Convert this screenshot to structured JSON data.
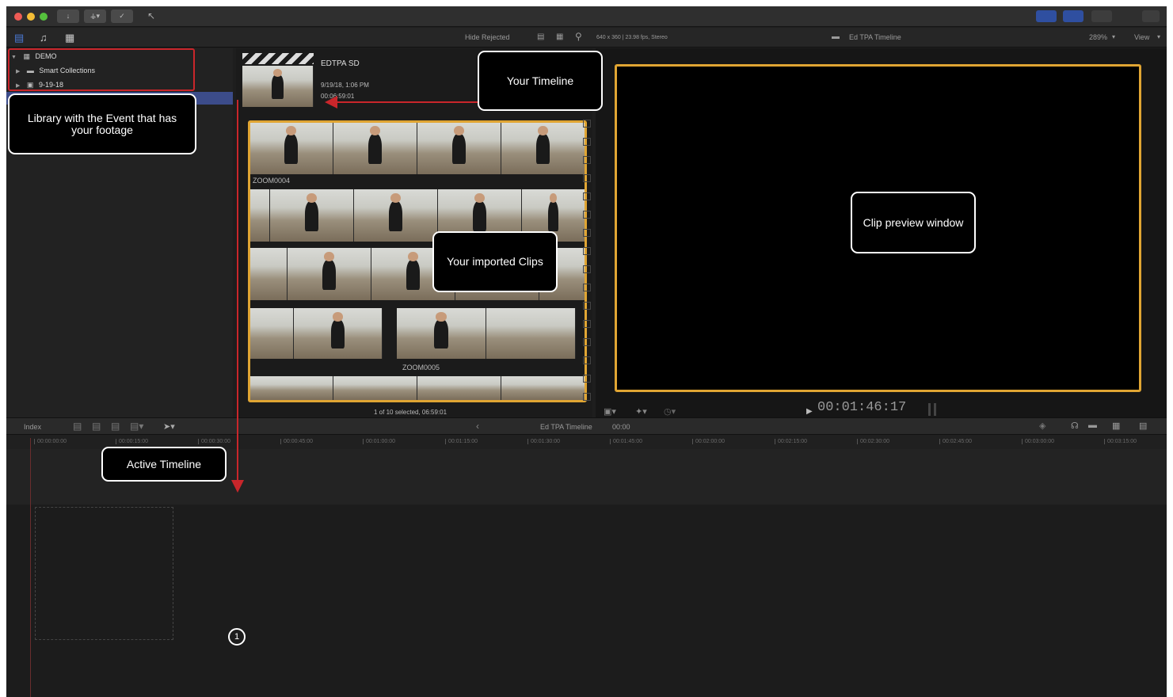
{
  "toolbar": {
    "hide_rejected": "Hide Rejected",
    "format_info": "640 x 360 | 23.98 fps, Stereo",
    "timeline_name": "Ed TPA Timeline",
    "zoom": "289%",
    "view": "View"
  },
  "library": {
    "items": [
      {
        "label": "DEMO"
      },
      {
        "label": "Smart Collections"
      },
      {
        "label": "9-19-18"
      }
    ]
  },
  "browser": {
    "project": {
      "title": "EDTPA SD",
      "date": "9/19/18, 1:06 PM",
      "duration": "00:06:59:01"
    },
    "clips": [
      "ZOOM0004",
      "ZOOM0005"
    ],
    "status": "1 of 10 selected, 06:59:01"
  },
  "viewer": {
    "timecode": "00:01:46:17"
  },
  "timeline_bar": {
    "index": "Index",
    "timeline_name": "Ed TPA Timeline",
    "timecode": "00:00"
  },
  "ruler": {
    "ticks": [
      "00:00:00:00",
      "00:00:15:00",
      "00:00:30:00",
      "00:00:45:00",
      "00:01:00:00",
      "00:01:15:00",
      "00:01:30:00",
      "00:01:45:00",
      "00:02:00:00",
      "00:02:15:00",
      "00:02:30:00",
      "00:02:45:00",
      "00:03:00:00",
      "00:03:15:00"
    ]
  },
  "annotations": {
    "library": "Library with the Event that has your footage",
    "your_timeline": "Your Timeline",
    "clip_preview": "Clip preview window",
    "imported_clips": "Your imported Clips",
    "active_timeline": "Active Timeline",
    "step_number": "1"
  },
  "colors": {
    "selection_border": "#e0a533",
    "annotation_red": "#c9262b",
    "sidebar_selection": "#3c4c8a"
  }
}
